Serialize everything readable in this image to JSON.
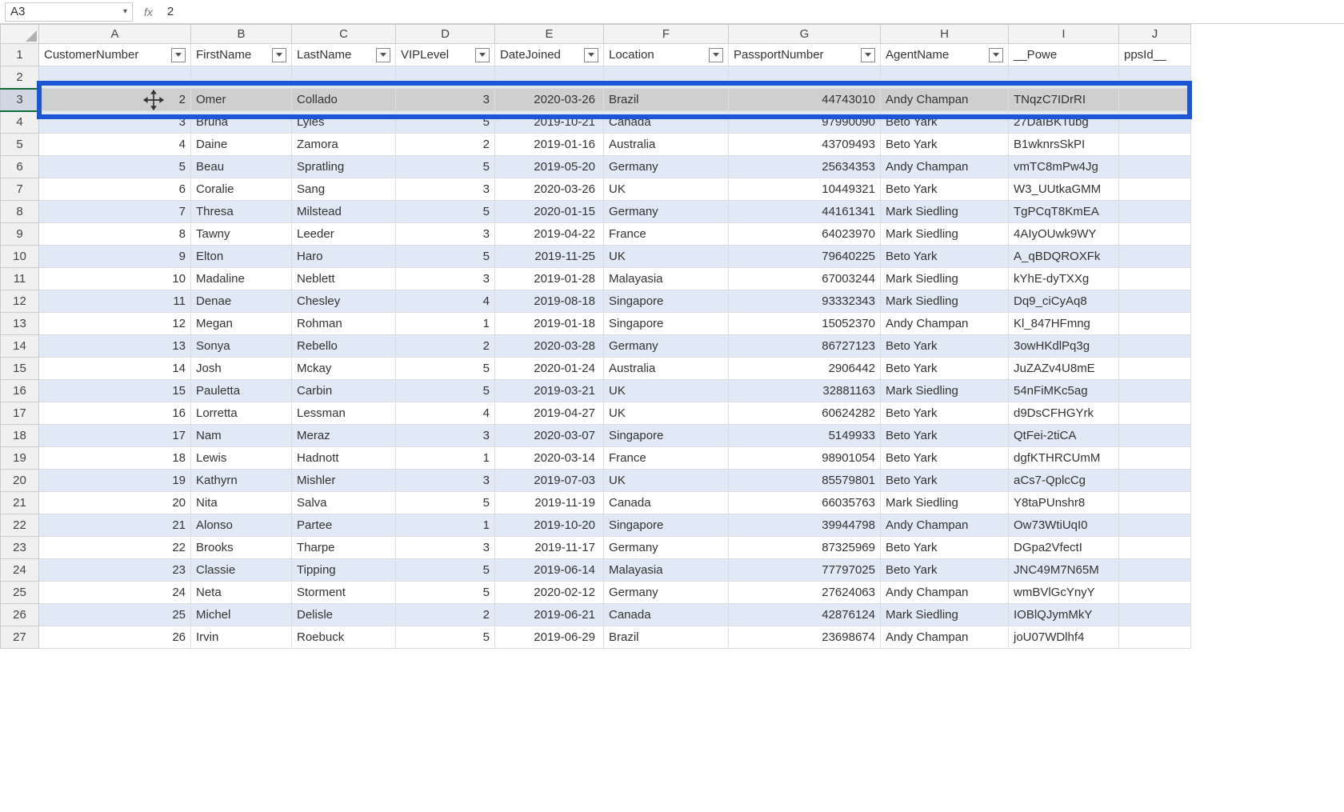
{
  "formula_bar": {
    "namebox": "A3",
    "fx_label": "fx",
    "formula": "2"
  },
  "column_letters": [
    "A",
    "B",
    "C",
    "D",
    "E",
    "F",
    "G",
    "H",
    "I",
    "J"
  ],
  "headers": [
    "CustomerNumber",
    "FirstName",
    "LastName",
    "VIPLevel",
    "DateJoined",
    "Location",
    "PassportNumber",
    "AgentName",
    "__Powe",
    "ppsId__"
  ],
  "selected_row": 3,
  "visible_row_start": 1,
  "visible_row_end": 27,
  "chart_data": {
    "type": "table",
    "columns": [
      "CustomerNumber",
      "FirstName",
      "LastName",
      "VIPLevel",
      "DateJoined",
      "Location",
      "PassportNumber",
      "AgentName",
      "__PowerAppsId__"
    ],
    "rows": [
      {
        "r": 2,
        "CustomerNumber": "",
        "FirstName": "",
        "LastName": "",
        "VIPLevel": "",
        "DateJoined": "",
        "Location": "",
        "PassportNumber": "",
        "AgentName": "",
        "PowerAppsId": ""
      },
      {
        "r": 3,
        "CustomerNumber": "2",
        "FirstName": "Omer",
        "LastName": "Collado",
        "VIPLevel": "3",
        "DateJoined": "2020-03-26",
        "Location": "Brazil",
        "PassportNumber": "44743010",
        "AgentName": "Andy Champan",
        "PowerAppsId": "TNqzC7IDrRI"
      },
      {
        "r": 4,
        "CustomerNumber": "3",
        "FirstName": "Bruna",
        "LastName": "Lyles",
        "VIPLevel": "5",
        "DateJoined": "2019-10-21",
        "Location": "Canada",
        "PassportNumber": "97990090",
        "AgentName": "Beto Yark",
        "PowerAppsId": "27DaIBKTubg"
      },
      {
        "r": 5,
        "CustomerNumber": "4",
        "FirstName": "Daine",
        "LastName": "Zamora",
        "VIPLevel": "2",
        "DateJoined": "2019-01-16",
        "Location": "Australia",
        "PassportNumber": "43709493",
        "AgentName": "Beto Yark",
        "PowerAppsId": "B1wknrsSkPI"
      },
      {
        "r": 6,
        "CustomerNumber": "5",
        "FirstName": "Beau",
        "LastName": "Spratling",
        "VIPLevel": "5",
        "DateJoined": "2019-05-20",
        "Location": "Germany",
        "PassportNumber": "25634353",
        "AgentName": "Andy Champan",
        "PowerAppsId": "vmTC8mPw4Jg"
      },
      {
        "r": 7,
        "CustomerNumber": "6",
        "FirstName": "Coralie",
        "LastName": "Sang",
        "VIPLevel": "3",
        "DateJoined": "2020-03-26",
        "Location": "UK",
        "PassportNumber": "10449321",
        "AgentName": "Beto Yark",
        "PowerAppsId": "W3_UUtkaGMM"
      },
      {
        "r": 8,
        "CustomerNumber": "7",
        "FirstName": "Thresa",
        "LastName": "Milstead",
        "VIPLevel": "5",
        "DateJoined": "2020-01-15",
        "Location": "Germany",
        "PassportNumber": "44161341",
        "AgentName": "Mark Siedling",
        "PowerAppsId": "TgPCqT8KmEA"
      },
      {
        "r": 9,
        "CustomerNumber": "8",
        "FirstName": "Tawny",
        "LastName": "Leeder",
        "VIPLevel": "3",
        "DateJoined": "2019-04-22",
        "Location": "France",
        "PassportNumber": "64023970",
        "AgentName": "Mark Siedling",
        "PowerAppsId": "4AIyOUwk9WY"
      },
      {
        "r": 10,
        "CustomerNumber": "9",
        "FirstName": "Elton",
        "LastName": "Haro",
        "VIPLevel": "5",
        "DateJoined": "2019-11-25",
        "Location": "UK",
        "PassportNumber": "79640225",
        "AgentName": "Beto Yark",
        "PowerAppsId": "A_qBDQROXFk"
      },
      {
        "r": 11,
        "CustomerNumber": "10",
        "FirstName": "Madaline",
        "LastName": "Neblett",
        "VIPLevel": "3",
        "DateJoined": "2019-01-28",
        "Location": "Malayasia",
        "PassportNumber": "67003244",
        "AgentName": "Mark Siedling",
        "PowerAppsId": "kYhE-dyTXXg"
      },
      {
        "r": 12,
        "CustomerNumber": "11",
        "FirstName": "Denae",
        "LastName": "Chesley",
        "VIPLevel": "4",
        "DateJoined": "2019-08-18",
        "Location": "Singapore",
        "PassportNumber": "93332343",
        "AgentName": "Mark Siedling",
        "PowerAppsId": "Dq9_ciCyAq8"
      },
      {
        "r": 13,
        "CustomerNumber": "12",
        "FirstName": "Megan",
        "LastName": "Rohman",
        "VIPLevel": "1",
        "DateJoined": "2019-01-18",
        "Location": "Singapore",
        "PassportNumber": "15052370",
        "AgentName": "Andy Champan",
        "PowerAppsId": "Kl_847HFmng"
      },
      {
        "r": 14,
        "CustomerNumber": "13",
        "FirstName": "Sonya",
        "LastName": "Rebello",
        "VIPLevel": "2",
        "DateJoined": "2020-03-28",
        "Location": "Germany",
        "PassportNumber": "86727123",
        "AgentName": "Beto Yark",
        "PowerAppsId": "3owHKdlPq3g"
      },
      {
        "r": 15,
        "CustomerNumber": "14",
        "FirstName": "Josh",
        "LastName": "Mckay",
        "VIPLevel": "5",
        "DateJoined": "2020-01-24",
        "Location": "Australia",
        "PassportNumber": "2906442",
        "AgentName": "Beto Yark",
        "PowerAppsId": "JuZAZv4U8mE"
      },
      {
        "r": 16,
        "CustomerNumber": "15",
        "FirstName": "Pauletta",
        "LastName": "Carbin",
        "VIPLevel": "5",
        "DateJoined": "2019-03-21",
        "Location": "UK",
        "PassportNumber": "32881163",
        "AgentName": "Mark Siedling",
        "PowerAppsId": "54nFiMKc5ag"
      },
      {
        "r": 17,
        "CustomerNumber": "16",
        "FirstName": "Lorretta",
        "LastName": "Lessman",
        "VIPLevel": "4",
        "DateJoined": "2019-04-27",
        "Location": "UK",
        "PassportNumber": "60624282",
        "AgentName": "Beto Yark",
        "PowerAppsId": "d9DsCFHGYrk"
      },
      {
        "r": 18,
        "CustomerNumber": "17",
        "FirstName": "Nam",
        "LastName": "Meraz",
        "VIPLevel": "3",
        "DateJoined": "2020-03-07",
        "Location": "Singapore",
        "PassportNumber": "5149933",
        "AgentName": "Beto Yark",
        "PowerAppsId": "QtFei-2tiCA"
      },
      {
        "r": 19,
        "CustomerNumber": "18",
        "FirstName": "Lewis",
        "LastName": "Hadnott",
        "VIPLevel": "1",
        "DateJoined": "2020-03-14",
        "Location": "France",
        "PassportNumber": "98901054",
        "AgentName": "Beto Yark",
        "PowerAppsId": "dgfKTHRCUmM"
      },
      {
        "r": 20,
        "CustomerNumber": "19",
        "FirstName": "Kathyrn",
        "LastName": "Mishler",
        "VIPLevel": "3",
        "DateJoined": "2019-07-03",
        "Location": "UK",
        "PassportNumber": "85579801",
        "AgentName": "Beto Yark",
        "PowerAppsId": "aCs7-QplcCg"
      },
      {
        "r": 21,
        "CustomerNumber": "20",
        "FirstName": "Nita",
        "LastName": "Salva",
        "VIPLevel": "5",
        "DateJoined": "2019-11-19",
        "Location": "Canada",
        "PassportNumber": "66035763",
        "AgentName": "Mark Siedling",
        "PowerAppsId": "Y8taPUnshr8"
      },
      {
        "r": 22,
        "CustomerNumber": "21",
        "FirstName": "Alonso",
        "LastName": "Partee",
        "VIPLevel": "1",
        "DateJoined": "2019-10-20",
        "Location": "Singapore",
        "PassportNumber": "39944798",
        "AgentName": "Andy Champan",
        "PowerAppsId": "Ow73WtiUqI0"
      },
      {
        "r": 23,
        "CustomerNumber": "22",
        "FirstName": "Brooks",
        "LastName": "Tharpe",
        "VIPLevel": "3",
        "DateJoined": "2019-11-17",
        "Location": "Germany",
        "PassportNumber": "87325969",
        "AgentName": "Beto Yark",
        "PowerAppsId": "DGpa2VfectI"
      },
      {
        "r": 24,
        "CustomerNumber": "23",
        "FirstName": "Classie",
        "LastName": "Tipping",
        "VIPLevel": "5",
        "DateJoined": "2019-06-14",
        "Location": "Malayasia",
        "PassportNumber": "77797025",
        "AgentName": "Beto Yark",
        "PowerAppsId": "JNC49M7N65M"
      },
      {
        "r": 25,
        "CustomerNumber": "24",
        "FirstName": "Neta",
        "LastName": "Storment",
        "VIPLevel": "5",
        "DateJoined": "2020-02-12",
        "Location": "Germany",
        "PassportNumber": "27624063",
        "AgentName": "Andy Champan",
        "PowerAppsId": "wmBVlGcYnyY"
      },
      {
        "r": 26,
        "CustomerNumber": "25",
        "FirstName": "Michel",
        "LastName": "Delisle",
        "VIPLevel": "2",
        "DateJoined": "2019-06-21",
        "Location": "Canada",
        "PassportNumber": "42876124",
        "AgentName": "Mark Siedling",
        "PowerAppsId": "IOBlQJymMkY"
      },
      {
        "r": 27,
        "CustomerNumber": "26",
        "FirstName": "Irvin",
        "LastName": "Roebuck",
        "VIPLevel": "5",
        "DateJoined": "2019-06-29",
        "Location": "Brazil",
        "PassportNumber": "23698674",
        "AgentName": "Andy Champan",
        "PowerAppsId": "joU07WDlhf4"
      }
    ]
  }
}
